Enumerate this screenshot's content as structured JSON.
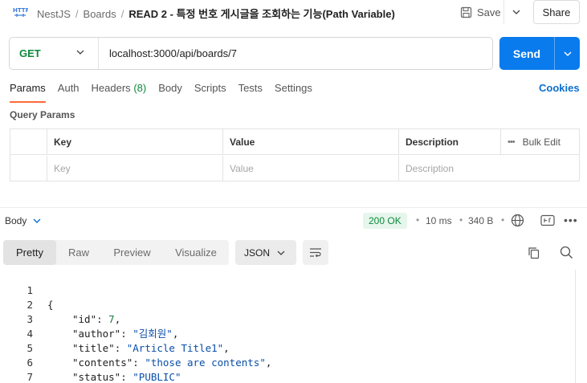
{
  "header": {
    "breadcrumbs": [
      "NestJS",
      "Boards"
    ],
    "title": "READ 2 - 특정 번호 게시글을 조회하는 기능(Path Variable)",
    "separator": "/",
    "save_label": "Save",
    "share_label": "Share"
  },
  "request": {
    "method": "GET",
    "url": "localhost:3000/api/boards/7",
    "send_label": "Send",
    "tabs": [
      {
        "label": "Params",
        "count": ""
      },
      {
        "label": "Auth",
        "count": ""
      },
      {
        "label": "Headers",
        "count": "(8)"
      },
      {
        "label": "Body",
        "count": ""
      },
      {
        "label": "Scripts",
        "count": ""
      },
      {
        "label": "Tests",
        "count": ""
      },
      {
        "label": "Settings",
        "count": ""
      }
    ],
    "cookies_label": "Cookies",
    "query_params_title": "Query Params",
    "table": {
      "headers": [
        "Key",
        "Value",
        "Description"
      ],
      "bulk_edit_label": "Bulk Edit",
      "placeholders": [
        "Key",
        "Value",
        "Description"
      ]
    }
  },
  "response": {
    "label": "Body",
    "status": "200 OK",
    "time": "10 ms",
    "size": "340 B",
    "views": [
      "Pretty",
      "Raw",
      "Preview",
      "Visualize"
    ],
    "active_view": "Pretty",
    "format": "JSON",
    "lines": [
      {
        "num": "1",
        "text": "{"
      },
      {
        "num": "2",
        "key": "\"id\"",
        "value": "7",
        "type": "number",
        "comma": ","
      },
      {
        "num": "3",
        "key": "\"author\"",
        "value": "\"김회원\"",
        "type": "string",
        "comma": ","
      },
      {
        "num": "4",
        "key": "\"title\"",
        "value": "\"Article Title1\"",
        "type": "string",
        "comma": ","
      },
      {
        "num": "5",
        "key": "\"contents\"",
        "value": "\"those are contents\"",
        "type": "string",
        "comma": ","
      },
      {
        "num": "6",
        "key": "\"status\"",
        "value": "\"PUBLIC\"",
        "type": "string",
        "comma": ""
      },
      {
        "num": "7",
        "text": "}"
      }
    ]
  },
  "colors": {
    "accent_orange": "#ff6c37",
    "send_blue": "#097bed",
    "method_green": "#0c8a3c",
    "link_blue": "#0b6fcf"
  }
}
